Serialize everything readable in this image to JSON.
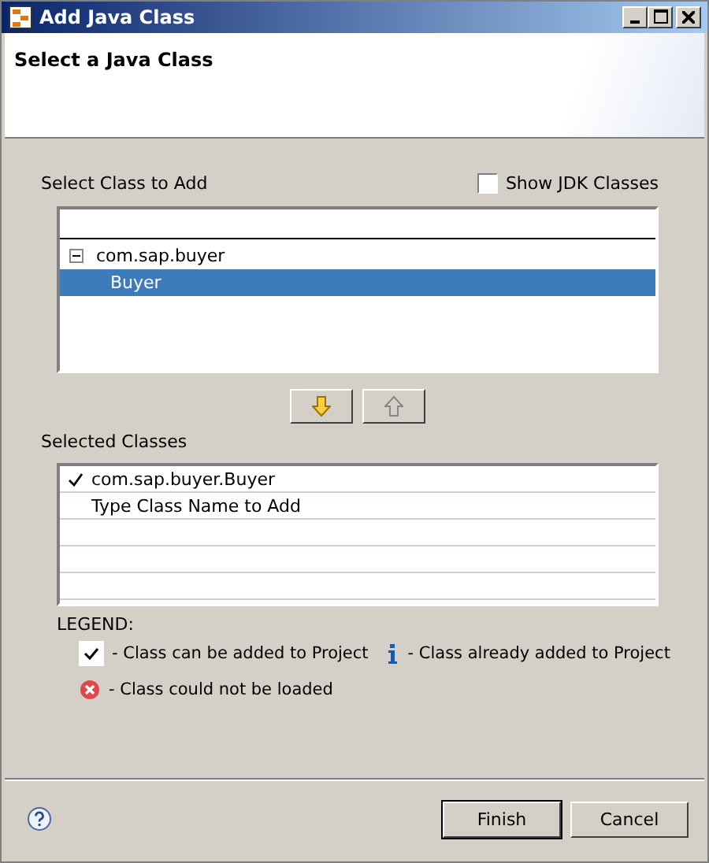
{
  "window": {
    "title": "Add Java Class"
  },
  "header": {
    "title": "Select a Java Class"
  },
  "class_picker": {
    "label": "Select Class to Add",
    "show_jdk": {
      "label": "Show JDK Classes",
      "checked": false
    },
    "tree": [
      {
        "label": "com.sap.buyer",
        "expanded": true,
        "selected": false,
        "children": [
          {
            "label": "Buyer",
            "selected": true
          }
        ]
      }
    ]
  },
  "move_buttons": [
    {
      "kind": "down",
      "disabled": false
    },
    {
      "kind": "up",
      "disabled": true
    }
  ],
  "selected_classes": {
    "label": "Selected Classes",
    "rows": [
      {
        "text": "com.sap.buyer.Buyer",
        "checked": true
      },
      {
        "text": "Type Class Name to Add",
        "checked": false
      }
    ]
  },
  "legend": {
    "title": "LEGEND:",
    "items": [
      {
        "kind": "check",
        "text": "- Class can be added to Project"
      },
      {
        "kind": "info",
        "text": "- Class already added to Project"
      },
      {
        "kind": "error",
        "text": "- Class could not be loaded"
      }
    ]
  },
  "buttons": [
    {
      "label": "Finish",
      "default": true
    },
    {
      "label": "Cancel",
      "default": false
    }
  ]
}
